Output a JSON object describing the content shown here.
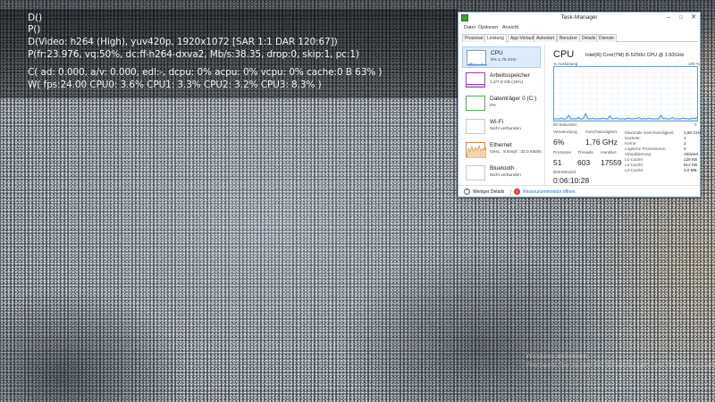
{
  "osd": {
    "lines": [
      "D()",
      "P()",
      "D(Video: h264 (High), yuv420p, 1920x1072 [SAR 1:1 DAR 120:67])",
      "P(fr:23.976, vq:50%, dc:ff-h264-dxva2, Mb/s:38.35, drop:0, skip:1, pc:1)",
      "C( ad: 0.000, a/v: 0.000, edl:-, dcpu: 0% acpu: 0% vcpu: 0% cache:0  B  63% )",
      "W( fps:24.00 CPU0: 3.6% CPU1: 3.3% CPU2: 3.2% CPU3: 8.3% )"
    ]
  },
  "watermark": {
    "line1": "Windows aktivieren",
    "line2": "Wechseln Sie zu den PC-Einstellungen, um Windows zu aktivieren."
  },
  "taskmanager": {
    "title": "Task-Manager",
    "menu": [
      "Datei",
      "Optionen",
      "Ansicht"
    ],
    "tabs": [
      "Prozesse",
      "Leistung",
      "App-Verlauf",
      "Autostart",
      "Benutzer",
      "Details",
      "Dienste"
    ],
    "active_tab": "Leistung",
    "resources": [
      {
        "name": "CPU",
        "sub": "6% 1,76 GHz",
        "color": "#4a90d9"
      },
      {
        "name": "Arbeitsspeicher",
        "sub": "1,2/7,9 GB (15%)",
        "color": "#9b3fb5"
      },
      {
        "name": "Datenträger 0 (C:)",
        "sub": "0%",
        "color": "#4caf50"
      },
      {
        "name": "Wi-Fi",
        "sub": "Nicht verbunden",
        "color": "#c8c8c8"
      },
      {
        "name": "Ethernet",
        "sub": "Gesc.: 8 Empf.: 32,0 KBit/s",
        "color": "#d58a3a"
      },
      {
        "name": "Bluetooth",
        "sub": "Nicht verbunden",
        "color": "#c8c8c8"
      }
    ],
    "detail": {
      "heading": "CPU",
      "model": "Intel(R) Core(TM) i5-5250U CPU @ 1.60GHz",
      "graph_top_label": "% Auslastung",
      "graph_top_right": "100 %",
      "graph_bottom_left": "60 Sekunden",
      "graph_bottom_right": "0",
      "cpu_history_percent": [
        3,
        4,
        3,
        5,
        3,
        4,
        10,
        3,
        4,
        3,
        6,
        3,
        4,
        13,
        4,
        3,
        5,
        3,
        4,
        3,
        5,
        4,
        3,
        9,
        3,
        4,
        5,
        3,
        4,
        3,
        4,
        5,
        3,
        4,
        4,
        6,
        3,
        4,
        3,
        5,
        4,
        3,
        4,
        3,
        10,
        4,
        5,
        3,
        4,
        6,
        3,
        4,
        3,
        5,
        4,
        4,
        3,
        5,
        4,
        6
      ],
      "stats": {
        "usage_label": "Verwendung",
        "usage_value": "6%",
        "speed_label": "Geschwindigkeit",
        "speed_value": "1,76 GHz",
        "processes_label": "Prozesse",
        "processes_value": "51",
        "threads_label": "Threads",
        "threads_value": "603",
        "handles_label": "Handles",
        "handles_value": "17559",
        "uptime_label": "Betriebszeit",
        "uptime_value": "0:06:10:28"
      },
      "specs": [
        {
          "label": "Maximale Geschwindigkeit:",
          "value": "1,60 GHz"
        },
        {
          "label": "Sockets:",
          "value": "1"
        },
        {
          "label": "Kerne:",
          "value": "2"
        },
        {
          "label": "Logische Prozessoren:",
          "value": "4"
        },
        {
          "label": "Virtualisierung:",
          "value": "Aktiviert"
        },
        {
          "label": "L1-Cache:",
          "value": "128 KB"
        },
        {
          "label": "L2-Cache:",
          "value": "512 KB"
        },
        {
          "label": "L3-Cache:",
          "value": "3,0 MB"
        }
      ]
    },
    "footer": {
      "fewer_details": "Weniger Details",
      "resource_monitor": "Ressourcenmonitor öffnen"
    },
    "colors": {
      "accent": "#1f6fc5",
      "graph_line": "#2d7fd0",
      "graph_fill": "#d6e6f7"
    }
  }
}
